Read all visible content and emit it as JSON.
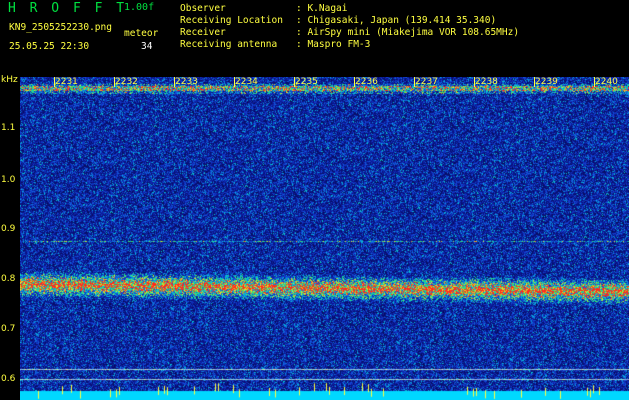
{
  "header": {
    "logo": "H R O F F T",
    "version": "1.00f",
    "filename": "KN9_2505252230.png",
    "datetime": "25.05.25 22:30",
    "meteor_label": "meteor",
    "meteor_count": "34",
    "fields": [
      {
        "label": "Observer",
        "value": ": K.Nagai"
      },
      {
        "label": "Receiving Location",
        "value": ": Chigasaki, Japan (139.414 35.340)"
      },
      {
        "label": "Receiver",
        "value": ": AirSpy mini (Miakejima VOR 108.65MHz)"
      },
      {
        "label": "Receiving antenna",
        "value": ": Maspro FM-3"
      }
    ]
  },
  "yaxis": {
    "unit": "kHz",
    "ticks": [
      "1.1",
      "1.0",
      "0.9",
      "0.8",
      "0.7",
      "0.6"
    ]
  },
  "time_ticks": [
    "2231",
    "2232",
    "2233",
    "2234",
    "2235",
    "2236",
    "2237",
    "2238",
    "2239",
    "2240"
  ],
  "colors": {
    "header_text": "#ffff40",
    "logo": "#00e040",
    "background": "#000000",
    "spectrum_low": "#0a0f8a",
    "spectrum_high": "#ff2020",
    "bottom_band": "#00d8ff"
  }
}
